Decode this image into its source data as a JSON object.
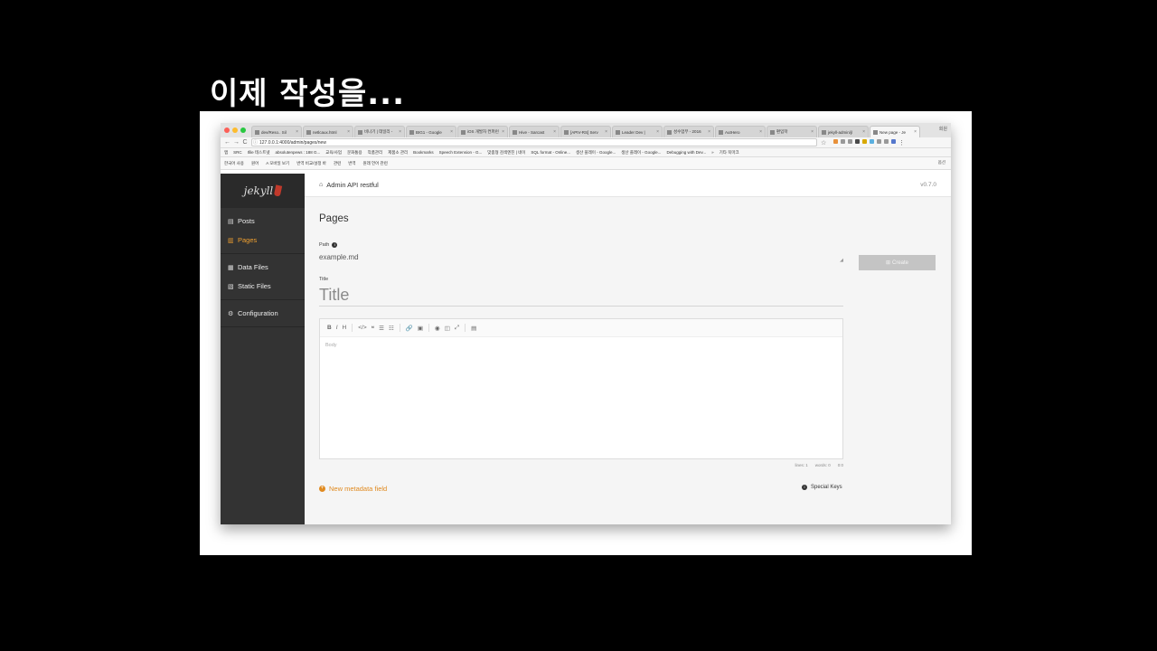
{
  "slide": {
    "title": "이제 작성을..."
  },
  "browser": {
    "tabs": [
      {
        "label": "dev/Reso.. Sil"
      },
      {
        "label": "netlcaux.html"
      },
      {
        "label": "비나기 | 데일리 -"
      },
      {
        "label": "BIG1 - Google"
      },
      {
        "label": "iOS 개발자 컨퍼런"
      },
      {
        "label": "Hive - Sarcast"
      },
      {
        "label": "[APIV-RS] Serv"
      },
      {
        "label": "Leader Dev |"
      },
      {
        "label": "성수업무 - 2016"
      },
      {
        "label": "AutHero"
      },
      {
        "label": "편입학"
      },
      {
        "label": "jekyll-admin/jl"
      },
      {
        "label": "New page - Je"
      }
    ],
    "profile": "회원",
    "url": "127.0.0.1:4000/admin/pages/new",
    "bookmarks": [
      "앱",
      "SRC",
      "Ifile 테스트넷",
      "absolutenpews : 188 G...",
      "교육/사업",
      "문화통용",
      "작품관리",
      "제품소 관리",
      "Bookmarks",
      "Speech Extension - G...",
      "맞춤형 검색엔진 | 네이",
      "SQL format - Online...",
      "생산 플레이 - Google...",
      "생산 플레이 - Google...",
      "Debugging with Dev...",
      "»",
      "기타 북마크"
    ],
    "extbar": [
      "한국어 사용",
      "원어",
      "A 모바일 보기",
      "번역 비교/설정 바",
      "관련",
      "번역",
      "원래 언어 관련"
    ],
    "extbar_right": "옵션"
  },
  "app": {
    "logo": "jekyll",
    "nav": [
      [
        {
          "label": "Posts",
          "icon": "posts-icon",
          "active": false
        },
        {
          "label": "Pages",
          "icon": "pages-icon",
          "active": true
        }
      ],
      [
        {
          "label": "Data Files",
          "icon": "data-files-icon",
          "active": false
        },
        {
          "label": "Static Files",
          "icon": "static-files-icon",
          "active": false
        }
      ],
      [
        {
          "label": "Configuration",
          "icon": "gear-icon",
          "active": false
        }
      ]
    ],
    "breadcrumb": "Admin API restful",
    "version": "v0.7.0",
    "page_title": "Pages",
    "path_label": "Path",
    "path_value": "example.md",
    "create_label": "Create",
    "title_label": "Title",
    "title_placeholder": "Title",
    "body_placeholder": "Body",
    "editor_status": {
      "lines": "lines: 1",
      "words": "words: 0",
      "cursor": "0:0"
    },
    "new_metadata": "New metadata field",
    "special_keys": "Special Keys"
  }
}
